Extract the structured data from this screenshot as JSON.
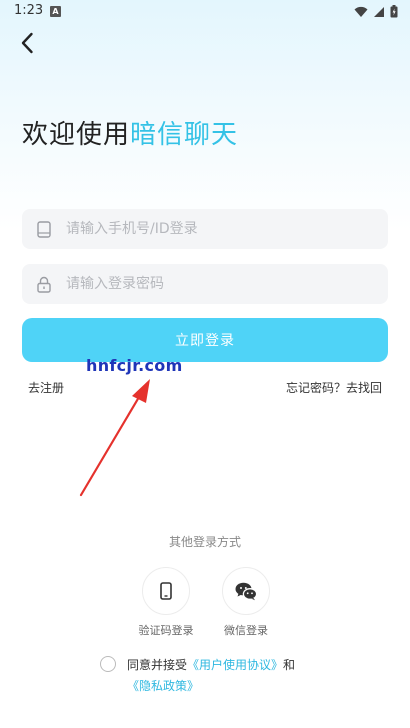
{
  "status_bar": {
    "time": "1:23",
    "app_icon_letter": "A"
  },
  "header": {
    "welcome_prefix": "欢迎使用",
    "app_name": "暗信聊天"
  },
  "form": {
    "phone_placeholder": "请输入手机号/ID登录",
    "password_placeholder": "请输入登录密码",
    "login_label": "立即登录",
    "register_label": "去注册",
    "forgot_label": "忘记密码？去找回"
  },
  "watermark": "hnfcjr.com",
  "other_login": {
    "title": "其他登录方式",
    "sms_label": "验证码登录",
    "wechat_label": "微信登录"
  },
  "agreement": {
    "prefix": "同意并接受",
    "user_agreement": "《用户使用协议》",
    "conjunction": "和",
    "privacy_policy": "《隐私政策》"
  },
  "colors": {
    "accent": "#34c2e6",
    "button": "#4fd3f7",
    "link": "#2fb8e0",
    "watermark": "#1f35b8",
    "arrow": "#e5322d"
  }
}
